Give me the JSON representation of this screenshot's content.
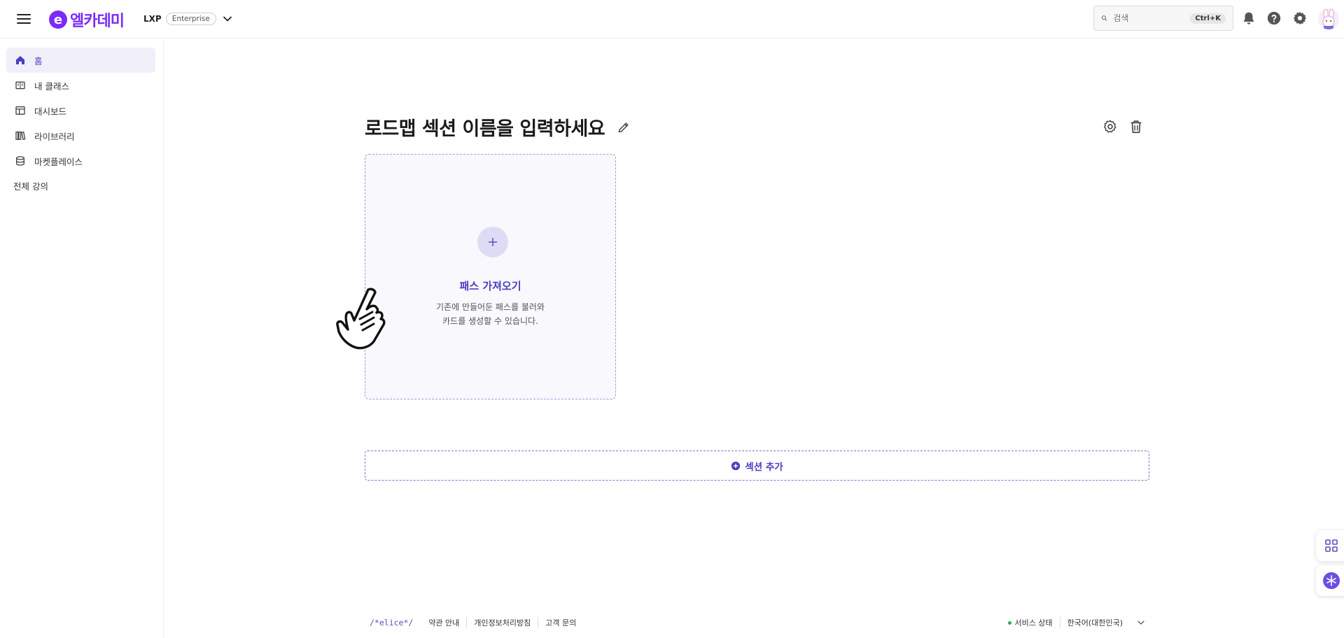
{
  "header": {
    "logo_text": "엘카데미",
    "logo_mark": "e",
    "org_name": "LXP",
    "org_badge": "Enterprise",
    "search_placeholder": "검색",
    "search_shortcut": "Ctrl+K",
    "icons": [
      "menu-icon",
      "chevron-down-icon",
      "search-icon",
      "bell-icon",
      "help-icon",
      "gear-icon"
    ]
  },
  "sidebar": {
    "items": [
      {
        "label": "홈",
        "icon": "home-icon",
        "active": true
      },
      {
        "label": "내 클래스",
        "icon": "book-icon",
        "active": false
      },
      {
        "label": "대시보드",
        "icon": "dashboard-icon",
        "active": false
      },
      {
        "label": "라이브러리",
        "icon": "library-icon",
        "active": false
      },
      {
        "label": "마켓플레이스",
        "icon": "database-icon",
        "active": false
      }
    ],
    "all_courses": "전체 강의"
  },
  "main": {
    "section_title": "로드맵 섹션 이름을 입력하세요",
    "import_card": {
      "title": "패스 가져오기",
      "desc_line1": "기존에 만들어둔 패스를 불러와",
      "desc_line2": "카드를 생성할 수 있습니다."
    },
    "add_section_label": "섹션 추가"
  },
  "footer": {
    "logo": "/*elice*/",
    "links": [
      "약관 안내",
      "개인정보처리방침",
      "고객 문의"
    ],
    "service_status": "서비스 상태",
    "language": "한국어(대한민국)"
  },
  "colors": {
    "brand": "#7b2bf9",
    "accent": "#4b3fc3",
    "active_bg": "#f0effa",
    "status_ok": "#20b25a"
  }
}
